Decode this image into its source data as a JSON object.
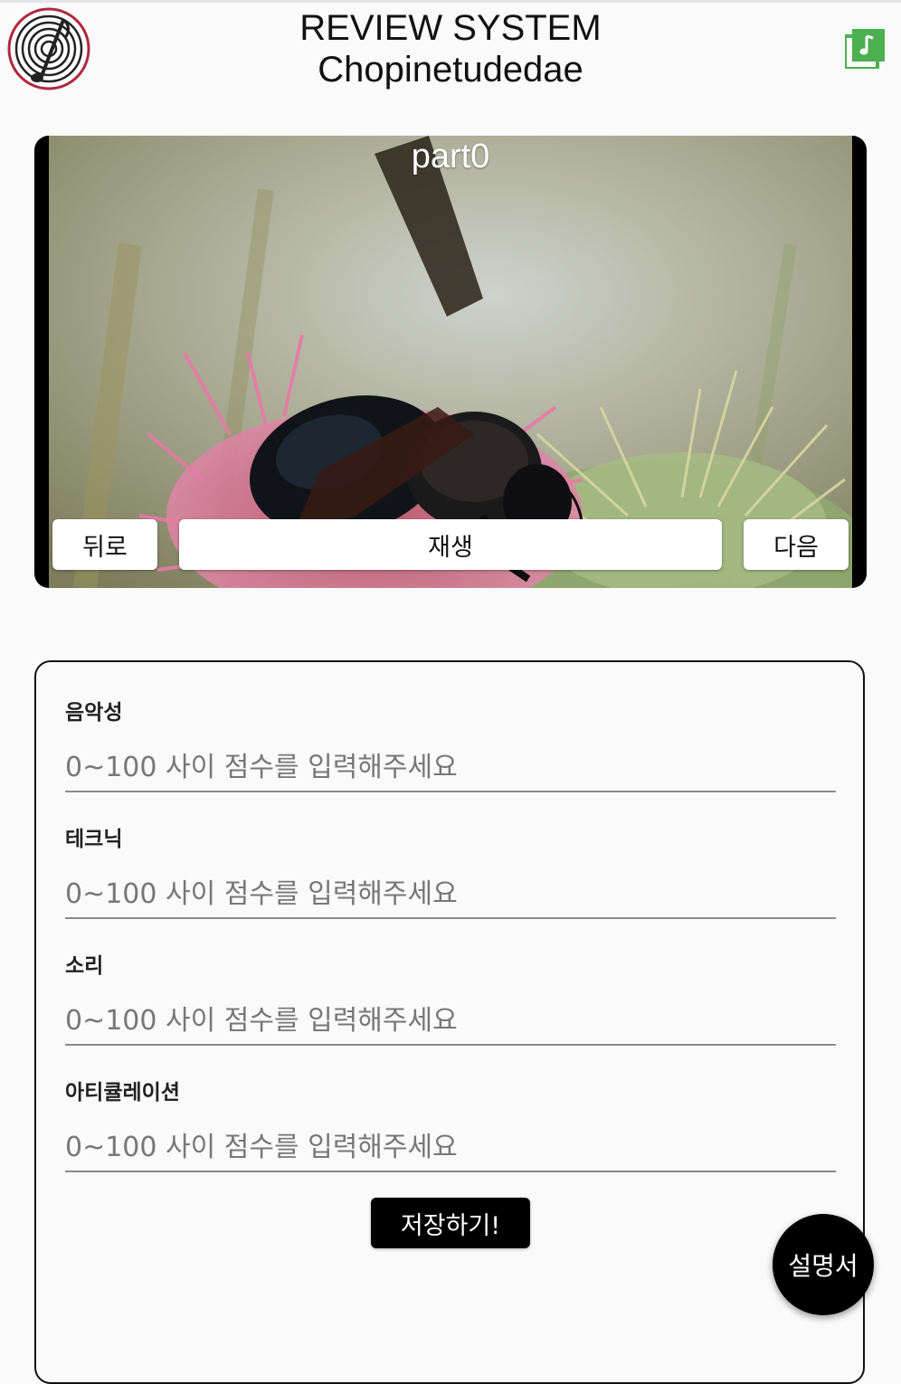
{
  "header": {
    "title_line1": "REVIEW SYSTEM",
    "title_line2": "Chopinetudedae",
    "logo_icon": "spiral-music-logo-icon",
    "music_icon": "music-library-icon"
  },
  "video": {
    "part_label": "part0",
    "back_label": "뒤로",
    "play_label": "재생",
    "next_label": "다음"
  },
  "form": {
    "fields": [
      {
        "label": "음악성",
        "placeholder": "0~100 사이 점수를 입력해주세요",
        "value": ""
      },
      {
        "label": "테크닉",
        "placeholder": "0~100 사이 점수를 입력해주세요",
        "value": ""
      },
      {
        "label": "소리",
        "placeholder": "0~100 사이 점수를 입력해주세요",
        "value": ""
      },
      {
        "label": "아티큘레이션",
        "placeholder": "0~100 사이 점수를 입력해주세요",
        "value": ""
      }
    ],
    "save_label": "저장하기!"
  },
  "fab": {
    "label": "설명서"
  },
  "colors": {
    "logo_ring": "#b0283f",
    "music_icon": "#4caf50",
    "button_dark": "#000000",
    "background": "#fafafa"
  }
}
